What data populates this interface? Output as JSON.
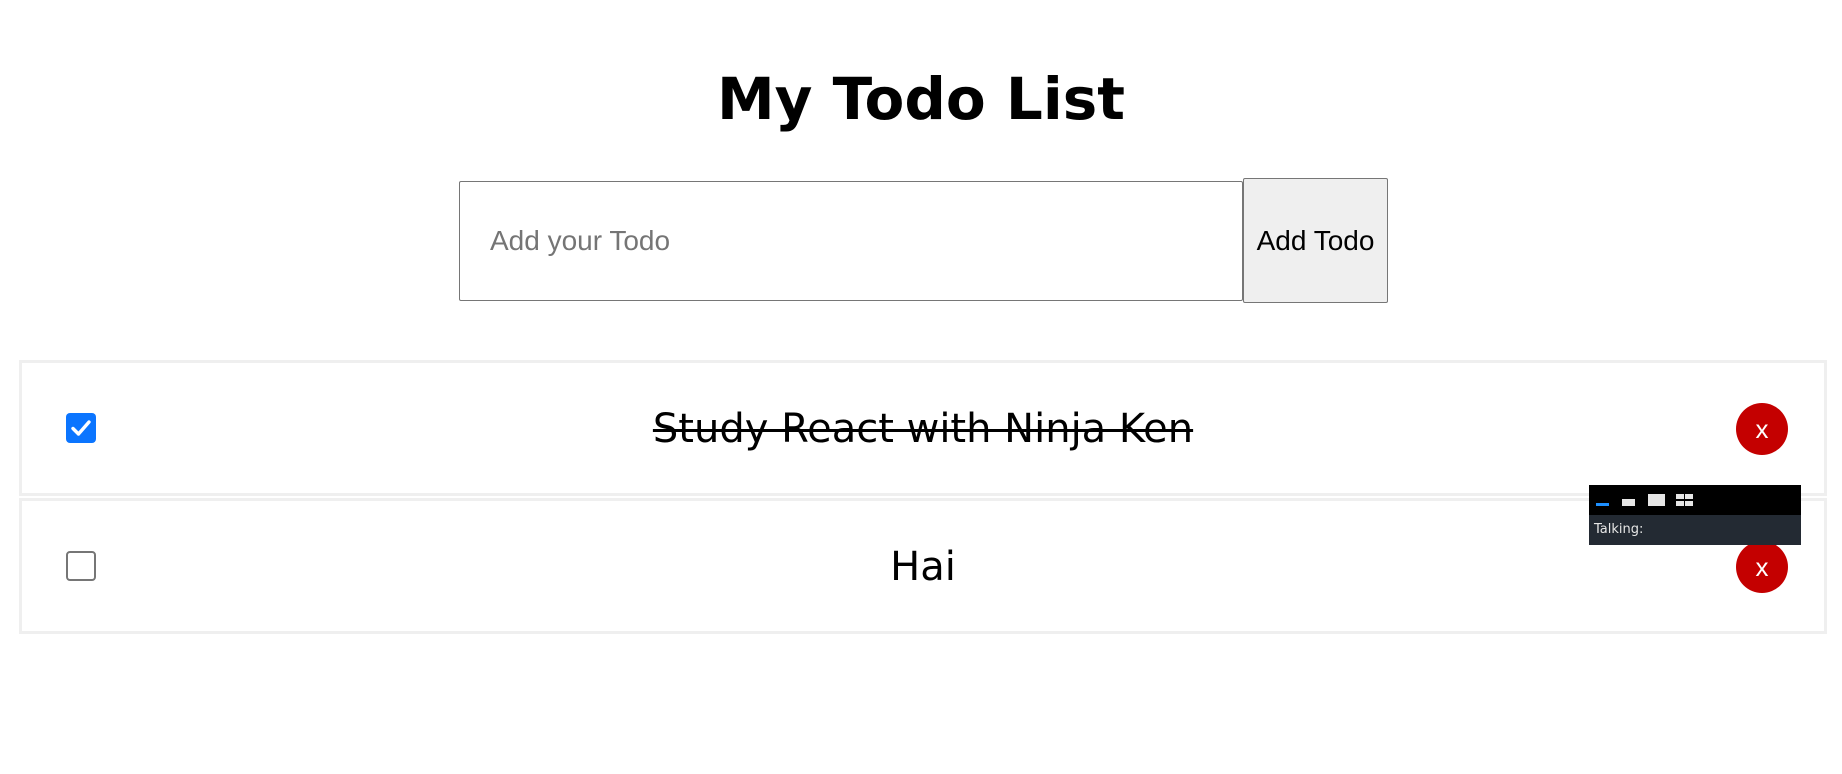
{
  "header": {
    "title": "My Todo List"
  },
  "form": {
    "placeholder": "Add your Todo",
    "value": "",
    "add_label": "Add Todo"
  },
  "todos": [
    {
      "text": "Study React with Ninja Ken",
      "done": true,
      "delete_label": "x"
    },
    {
      "text": "Hai",
      "done": false,
      "delete_label": "x"
    }
  ],
  "overlay": {
    "status_label": "Talking:",
    "icons": [
      "minimize-icon",
      "small-window-icon",
      "large-window-icon",
      "grid-window-icon"
    ]
  },
  "colors": {
    "checkbox_checked": "#0b75ff",
    "delete_button": "#c40000",
    "overlay_accent": "#1e90ff",
    "overlay_bar": "#000000",
    "overlay_status_bg": "#232a33"
  }
}
